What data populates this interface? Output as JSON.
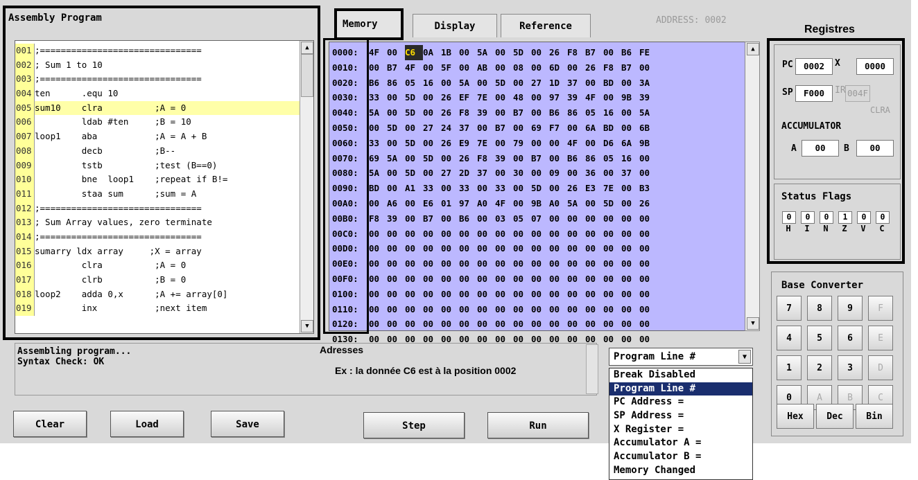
{
  "assembly": {
    "title": "Assembly Program",
    "lines": [
      {
        "num": "001",
        "text": ";==============================="
      },
      {
        "num": "002",
        "text": "; Sum 1 to 10"
      },
      {
        "num": "003",
        "text": ";==============================="
      },
      {
        "num": "004",
        "text": "ten      .equ 10"
      },
      {
        "num": "005",
        "text": "sum10    clra          ;A = 0"
      },
      {
        "num": "006",
        "text": "         ldab #ten     ;B = 10"
      },
      {
        "num": "007",
        "text": "loop1    aba           ;A = A + B"
      },
      {
        "num": "008",
        "text": "         decb          ;B--"
      },
      {
        "num": "009",
        "text": "         tstb          ;test (B==0)"
      },
      {
        "num": "010",
        "text": "         bne  loop1    ;repeat if B!="
      },
      {
        "num": "011",
        "text": "         staa sum      ;sum = A"
      },
      {
        "num": "012",
        "text": ";==============================="
      },
      {
        "num": "013",
        "text": "; Sum Array values, zero terminate"
      },
      {
        "num": "014",
        "text": ";==============================="
      },
      {
        "num": "015",
        "text": "sumarry ldx array     ;X = array"
      },
      {
        "num": "016",
        "text": "         clra          ;A = 0"
      },
      {
        "num": "017",
        "text": "         clrb          ;B = 0"
      },
      {
        "num": "018",
        "text": "loop2    adda 0,x      ;A += array[0]"
      },
      {
        "num": "019",
        "text": "         inx           ;next item"
      }
    ],
    "highlighted_line": "005"
  },
  "tabs": {
    "memory": "Memory",
    "display": "Display",
    "reference": "Reference"
  },
  "address_label": "ADDRESS: 0002",
  "memory": {
    "selected": {
      "row": 0,
      "col": 2
    },
    "rows": [
      {
        "addr": "0000:",
        "bytes": [
          "4F",
          "00",
          "C6",
          "0A",
          "1B",
          "00",
          "5A",
          "00",
          "5D",
          "00",
          "26",
          "F8",
          "B7",
          "00",
          "B6",
          "FE"
        ]
      },
      {
        "addr": "0010:",
        "bytes": [
          "00",
          "B7",
          "4F",
          "00",
          "5F",
          "00",
          "AB",
          "00",
          "08",
          "00",
          "6D",
          "00",
          "26",
          "F8",
          "B7",
          "00"
        ]
      },
      {
        "addr": "0020:",
        "bytes": [
          "B6",
          "86",
          "05",
          "16",
          "00",
          "5A",
          "00",
          "5D",
          "00",
          "27",
          "1D",
          "37",
          "00",
          "BD",
          "00",
          "3A"
        ]
      },
      {
        "addr": "0030:",
        "bytes": [
          "33",
          "00",
          "5D",
          "00",
          "26",
          "EF",
          "7E",
          "00",
          "48",
          "00",
          "97",
          "39",
          "4F",
          "00",
          "9B",
          "39"
        ]
      },
      {
        "addr": "0040:",
        "bytes": [
          "5A",
          "00",
          "5D",
          "00",
          "26",
          "F8",
          "39",
          "00",
          "B7",
          "00",
          "B6",
          "86",
          "05",
          "16",
          "00",
          "5A"
        ]
      },
      {
        "addr": "0050:",
        "bytes": [
          "00",
          "5D",
          "00",
          "27",
          "24",
          "37",
          "00",
          "B7",
          "00",
          "69",
          "F7",
          "00",
          "6A",
          "BD",
          "00",
          "6B"
        ]
      },
      {
        "addr": "0060:",
        "bytes": [
          "33",
          "00",
          "5D",
          "00",
          "26",
          "E9",
          "7E",
          "00",
          "79",
          "00",
          "00",
          "4F",
          "00",
          "D6",
          "6A",
          "9B"
        ]
      },
      {
        "addr": "0070:",
        "bytes": [
          "69",
          "5A",
          "00",
          "5D",
          "00",
          "26",
          "F8",
          "39",
          "00",
          "B7",
          "00",
          "B6",
          "86",
          "05",
          "16",
          "00"
        ]
      },
      {
        "addr": "0080:",
        "bytes": [
          "5A",
          "00",
          "5D",
          "00",
          "27",
          "2D",
          "37",
          "00",
          "30",
          "00",
          "09",
          "00",
          "36",
          "00",
          "37",
          "00"
        ]
      },
      {
        "addr": "0090:",
        "bytes": [
          "BD",
          "00",
          "A1",
          "33",
          "00",
          "33",
          "00",
          "33",
          "00",
          "5D",
          "00",
          "26",
          "E3",
          "7E",
          "00",
          "B3"
        ]
      },
      {
        "addr": "00A0:",
        "bytes": [
          "00",
          "A6",
          "00",
          "E6",
          "01",
          "97",
          "A0",
          "4F",
          "00",
          "9B",
          "A0",
          "5A",
          "00",
          "5D",
          "00",
          "26"
        ]
      },
      {
        "addr": "00B0:",
        "bytes": [
          "F8",
          "39",
          "00",
          "B7",
          "00",
          "B6",
          "00",
          "03",
          "05",
          "07",
          "00",
          "00",
          "00",
          "00",
          "00",
          "00"
        ]
      },
      {
        "addr": "00C0:",
        "bytes": [
          "00",
          "00",
          "00",
          "00",
          "00",
          "00",
          "00",
          "00",
          "00",
          "00",
          "00",
          "00",
          "00",
          "00",
          "00",
          "00"
        ]
      },
      {
        "addr": "00D0:",
        "bytes": [
          "00",
          "00",
          "00",
          "00",
          "00",
          "00",
          "00",
          "00",
          "00",
          "00",
          "00",
          "00",
          "00",
          "00",
          "00",
          "00"
        ]
      },
      {
        "addr": "00E0:",
        "bytes": [
          "00",
          "00",
          "00",
          "00",
          "00",
          "00",
          "00",
          "00",
          "00",
          "00",
          "00",
          "00",
          "00",
          "00",
          "00",
          "00"
        ]
      },
      {
        "addr": "00F0:",
        "bytes": [
          "00",
          "00",
          "00",
          "00",
          "00",
          "00",
          "00",
          "00",
          "00",
          "00",
          "00",
          "00",
          "00",
          "00",
          "00",
          "00"
        ]
      },
      {
        "addr": "0100:",
        "bytes": [
          "00",
          "00",
          "00",
          "00",
          "00",
          "00",
          "00",
          "00",
          "00",
          "00",
          "00",
          "00",
          "00",
          "00",
          "00",
          "00"
        ]
      },
      {
        "addr": "0110:",
        "bytes": [
          "00",
          "00",
          "00",
          "00",
          "00",
          "00",
          "00",
          "00",
          "00",
          "00",
          "00",
          "00",
          "00",
          "00",
          "00",
          "00"
        ]
      },
      {
        "addr": "0120:",
        "bytes": [
          "00",
          "00",
          "00",
          "00",
          "00",
          "00",
          "00",
          "00",
          "00",
          "00",
          "00",
          "00",
          "00",
          "00",
          "00",
          "00"
        ]
      },
      {
        "addr": "0130:",
        "bytes": [
          "00",
          "00",
          "00",
          "00",
          "00",
          "00",
          "00",
          "00",
          "00",
          "00",
          "00",
          "00",
          "00",
          "00",
          "00",
          "00"
        ]
      }
    ]
  },
  "output": {
    "line1": "Assembling program...",
    "line2": "Syntax Check: OK"
  },
  "annotations": {
    "addresses": "Adresses",
    "example": "Ex : la donnée C6 est à la position 0002",
    "registers": "Registres"
  },
  "buttons": {
    "clear": "Clear",
    "load": "Load",
    "save": "Save",
    "step": "Step",
    "run": "Run"
  },
  "break_select": {
    "value": "Program Line #",
    "options": [
      "Break Disabled",
      "Program Line #",
      "PC Address =",
      "SP Address =",
      "X Register =",
      "Accumulator A =",
      "Accumulator B =",
      "Memory Changed"
    ],
    "selected_index": 1
  },
  "registers": {
    "pc_label": "PC",
    "pc": "0002",
    "x_label": "X",
    "x": "0000",
    "sp_label": "SP",
    "sp": "F000",
    "ir_label": "IR",
    "ir": "004F",
    "instr": "CLRA",
    "acc_title": "ACCUMULATOR",
    "a_label": "A",
    "a": "00",
    "b_label": "B",
    "b": "00"
  },
  "flags": {
    "title": "Status Flags",
    "values": [
      "0",
      "0",
      "0",
      "1",
      "0",
      "0"
    ],
    "names": [
      "H",
      "I",
      "N",
      "Z",
      "V",
      "C"
    ]
  },
  "base_converter": {
    "title": "Base Converter",
    "keys": [
      [
        "7",
        "8",
        "9",
        "F"
      ],
      [
        "4",
        "5",
        "6",
        "E"
      ],
      [
        "1",
        "2",
        "3",
        "D"
      ],
      [
        "0",
        "A",
        "B",
        "C"
      ]
    ],
    "modes": [
      "Hex",
      "Dec",
      "Bin"
    ]
  }
}
